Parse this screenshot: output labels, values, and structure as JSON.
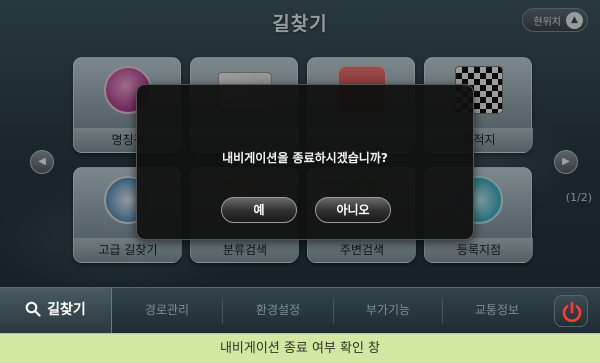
{
  "header": {
    "title": "길찾기",
    "current_position_label": "현위치"
  },
  "menu_tiles": [
    {
      "label": "명칭검"
    },
    {
      "label": ""
    },
    {
      "label": ""
    },
    {
      "label": "목적지"
    },
    {
      "label": "고급 길찾기"
    },
    {
      "label": "분류검색"
    },
    {
      "label": "주변검색"
    },
    {
      "label": "등록지점"
    }
  ],
  "pagination": {
    "indicator": "(1/2)"
  },
  "dialog": {
    "message": "내비게이션을 종료하시겠습니까?",
    "yes_label": "예",
    "no_label": "아니오"
  },
  "tabs": [
    {
      "label": "길찾기",
      "active": true
    },
    {
      "label": "경로관리"
    },
    {
      "label": "환경설정"
    },
    {
      "label": "부가기능"
    },
    {
      "label": "교통정보"
    }
  ],
  "caption": "내비게이션 종료 여부 확인 창",
  "colors": {
    "accent_power": "#ff3b2f",
    "caption_bg": "#d1e7a2",
    "dialog_bg": "#101010"
  }
}
